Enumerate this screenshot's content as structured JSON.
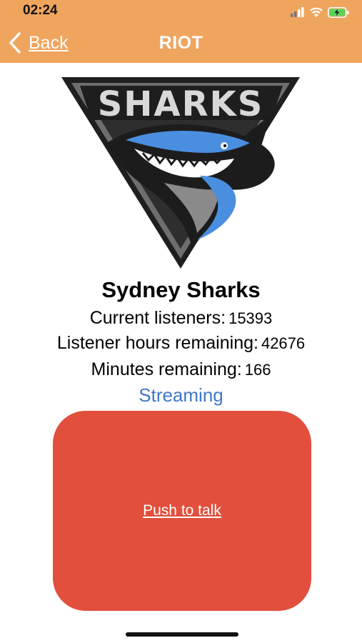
{
  "status_bar": {
    "time": "02:24",
    "icons": [
      "signal-icon",
      "wifi-icon",
      "battery-charging-icon"
    ]
  },
  "nav": {
    "back_label": "Back",
    "title": "RIOT"
  },
  "logo": {
    "text": "SHARKS",
    "colors": {
      "blue": "#4A8EE0",
      "dark": "#2A2A2A",
      "gray": "#8A8A8A"
    }
  },
  "team": {
    "name": "Sydney Sharks"
  },
  "stats": {
    "current_listeners_label": "Current listeners:",
    "current_listeners_value": "15393",
    "hours_label": "Listener hours remaining:",
    "hours_value": "42676",
    "minutes_label": "Minutes remaining:",
    "minutes_value": "166"
  },
  "status_text": "Streaming",
  "push_to_talk": {
    "label": "Push to talk"
  },
  "colors": {
    "header": "#F0A55E",
    "push_button": "#E24F3D",
    "streaming": "#3F78C8"
  }
}
